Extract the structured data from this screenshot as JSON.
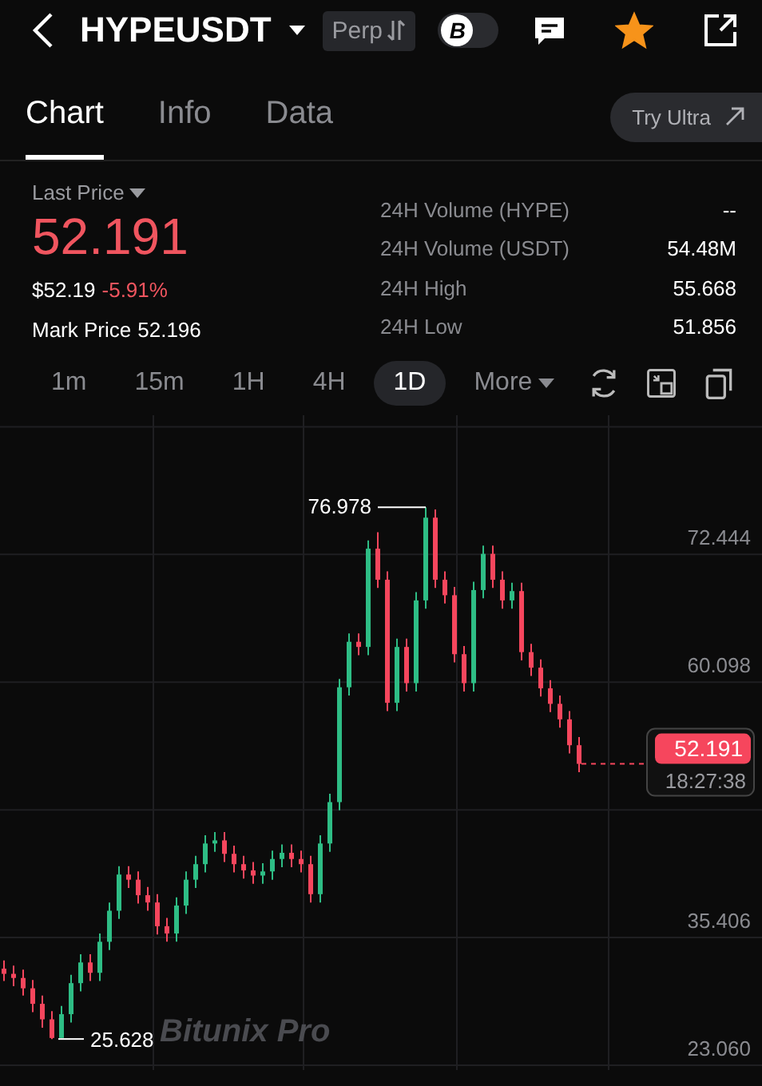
{
  "header": {
    "symbol": "HYPEUSDT",
    "market_type": "Perp",
    "badge_label": "B",
    "toggle_on": false,
    "favorite": true
  },
  "tabs": [
    {
      "label": "Chart",
      "selected": true
    },
    {
      "label": "Info",
      "selected": false
    },
    {
      "label": "Data",
      "selected": false
    }
  ],
  "try_ultra": "Try Ultra",
  "price": {
    "label": "Last Price",
    "last": "52.191",
    "usd": "$52.19",
    "change": "-5.91%",
    "mark_label": "Mark Price",
    "mark": "52.196"
  },
  "stats": [
    {
      "label": "24H Volume (HYPE)",
      "value": "--"
    },
    {
      "label": "24H Volume (USDT)",
      "value": "54.48M"
    },
    {
      "label": "24H High",
      "value": "55.668"
    },
    {
      "label": "24H Low",
      "value": "51.856"
    }
  ],
  "timeframes": [
    {
      "label": "1m",
      "selected": false
    },
    {
      "label": "15m",
      "selected": false
    },
    {
      "label": "1H",
      "selected": false
    },
    {
      "label": "4H",
      "selected": false
    },
    {
      "label": "1D",
      "selected": true
    },
    {
      "label": "More",
      "selected": false,
      "kind": "menu"
    }
  ],
  "chart": {
    "high_label": "76.978",
    "low_label": "25.628",
    "price_tag": "52.191",
    "countdown": "18:27:38",
    "brand": "Bitunix Pro",
    "chart_data": {
      "type": "candlestick",
      "grid": true,
      "yticks": [
        {
          "value": 23.06,
          "label": "23.060"
        },
        {
          "value": 35.406,
          "label": "35.406"
        },
        {
          "value": 60.098,
          "label": "60.098"
        },
        {
          "value": 72.444,
          "label": "72.444"
        }
      ],
      "ylim": [
        22.6,
        85.9
      ],
      "ohlc": [
        [
          32.4,
          33.2,
          31.2,
          31.9
        ],
        [
          31.9,
          32.7,
          30.7,
          31.5
        ],
        [
          31.5,
          32.3,
          29.8,
          30.5
        ],
        [
          30.5,
          31.3,
          28.2,
          29
        ],
        [
          29,
          29.8,
          26.7,
          27.5
        ],
        [
          27.5,
          28.3,
          25.6,
          25.7
        ],
        [
          25.7,
          28.8,
          25.7,
          28
        ],
        [
          28,
          31.8,
          27.2,
          31
        ],
        [
          31,
          33.8,
          30.2,
          33
        ],
        [
          33,
          33.8,
          31.2,
          32
        ],
        [
          32,
          35.8,
          31.2,
          35
        ],
        [
          35,
          38.8,
          34.2,
          38
        ],
        [
          38,
          42.3,
          37.2,
          41.5
        ],
        [
          41.5,
          42.3,
          40.2,
          41
        ],
        [
          41,
          41.8,
          38.7,
          39.5
        ],
        [
          39.5,
          40.3,
          38,
          38.8
        ],
        [
          38.8,
          39.6,
          35.7,
          36.5
        ],
        [
          36.5,
          37.3,
          35,
          35.8
        ],
        [
          35.8,
          39.3,
          35,
          38.5
        ],
        [
          38.5,
          41.8,
          37.7,
          41
        ],
        [
          41,
          43.3,
          40.2,
          42.5
        ],
        [
          42.5,
          45.3,
          41.7,
          44.5
        ],
        [
          44.5,
          45.6,
          43.7,
          44.8
        ],
        [
          44.8,
          45.6,
          42.7,
          43.5
        ],
        [
          43.5,
          44.3,
          41.7,
          42.5
        ],
        [
          42.5,
          43.3,
          41.1,
          41.9
        ],
        [
          41.9,
          42.7,
          40.6,
          41.4
        ],
        [
          41.4,
          42.6,
          40.6,
          41.8
        ],
        [
          41.8,
          43.8,
          41,
          43
        ],
        [
          43,
          44.4,
          42.2,
          43.6
        ],
        [
          43.6,
          44.4,
          42.2,
          43
        ],
        [
          43,
          43.8,
          41.7,
          42.5
        ],
        [
          42.5,
          43.3,
          38.8,
          39.6
        ],
        [
          39.6,
          45.3,
          38.8,
          44.5
        ],
        [
          44.5,
          49.3,
          43.7,
          48.5
        ],
        [
          48.5,
          60.4,
          47.7,
          59.6
        ],
        [
          59.6,
          64.8,
          58.8,
          64
        ],
        [
          64,
          64.8,
          62.7,
          63.5
        ],
        [
          63.5,
          73.8,
          62.7,
          73
        ],
        [
          73,
          74.6,
          69.2,
          70
        ],
        [
          70,
          70.8,
          57.3,
          58.1
        ],
        [
          58.1,
          64.3,
          57.3,
          63.5
        ],
        [
          63.5,
          64.3,
          59.2,
          60
        ],
        [
          60,
          68.8,
          59.2,
          68
        ],
        [
          68,
          77,
          67.2,
          76
        ],
        [
          76,
          76.8,
          69.2,
          70
        ],
        [
          70,
          70.8,
          67.7,
          68.5
        ],
        [
          68.5,
          69.3,
          62,
          62.8
        ],
        [
          62.8,
          63.6,
          59.2,
          60
        ],
        [
          60,
          69.8,
          59.2,
          69
        ],
        [
          69,
          73.3,
          68.2,
          72.5
        ],
        [
          72.5,
          73.3,
          69.2,
          70
        ],
        [
          70,
          70.8,
          67.2,
          68
        ],
        [
          68,
          69.7,
          67.2,
          68.9
        ],
        [
          68.9,
          69.7,
          62.2,
          63
        ],
        [
          63,
          63.8,
          60.7,
          61.5
        ],
        [
          61.5,
          62.3,
          58.7,
          59.5
        ],
        [
          59.5,
          60.3,
          57.2,
          58
        ],
        [
          58,
          58.8,
          55.7,
          56.5
        ],
        [
          56.5,
          57.3,
          53.2,
          54
        ],
        [
          54,
          54.8,
          51.4,
          52.2
        ]
      ]
    }
  }
}
